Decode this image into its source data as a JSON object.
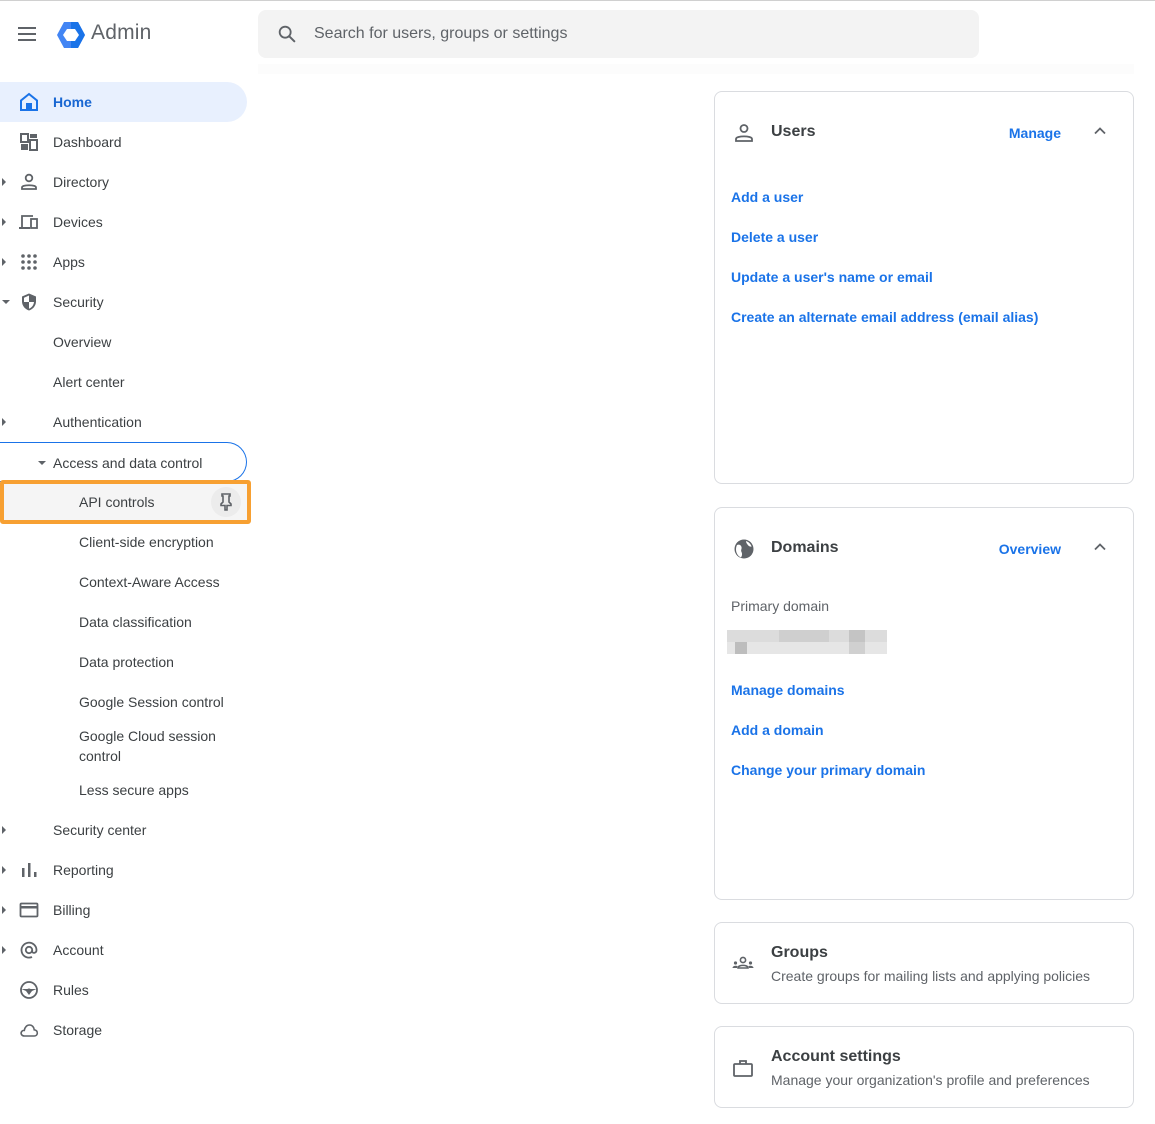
{
  "header": {
    "brand": "Admin",
    "search_placeholder": "Search for users, groups or settings",
    "search_value": ""
  },
  "sidebar": {
    "items": [
      {
        "label": "Home",
        "icon": "home-icon",
        "state": "selected"
      },
      {
        "label": "Dashboard",
        "icon": "dashboard-icon"
      },
      {
        "label": "Directory",
        "icon": "person-icon",
        "expandable": true
      },
      {
        "label": "Devices",
        "icon": "devices-icon",
        "expandable": true
      },
      {
        "label": "Apps",
        "icon": "apps-grid-icon",
        "expandable": true
      },
      {
        "label": "Security",
        "icon": "shield-icon",
        "expanded": true
      },
      {
        "label": "Overview"
      },
      {
        "label": "Alert center"
      },
      {
        "label": "Authentication",
        "expandable": true
      },
      {
        "label": "Access and data control",
        "expanded": true
      },
      {
        "label": "API controls",
        "highlighted": true,
        "pin_icon": "pin-icon"
      },
      {
        "label": "Client-side encryption"
      },
      {
        "label": "Context-Aware Access"
      },
      {
        "label": "Data classification"
      },
      {
        "label": "Data protection"
      },
      {
        "label": "Google Session control"
      },
      {
        "label": "Google Cloud session control"
      },
      {
        "label": "Less secure apps"
      },
      {
        "label": "Security center",
        "expandable": true
      },
      {
        "label": "Reporting",
        "icon": "bar-chart-icon",
        "expandable": true
      },
      {
        "label": "Billing",
        "icon": "credit-card-icon",
        "expandable": true
      },
      {
        "label": "Account",
        "icon": "at-sign-icon",
        "expandable": true
      },
      {
        "label": "Rules",
        "icon": "steering-wheel-icon"
      },
      {
        "label": "Storage",
        "icon": "cloud-icon"
      }
    ]
  },
  "cards": {
    "users": {
      "title": "Users",
      "action": "Manage",
      "links": [
        "Add a user",
        "Delete a user",
        "Update a user's name or email",
        "Create an alternate email address (email alias)"
      ]
    },
    "domains": {
      "title": "Domains",
      "action": "Overview",
      "primary_label": "Primary domain",
      "primary_value": "[redacted]",
      "links": [
        "Manage domains",
        "Add a domain",
        "Change your primary domain"
      ]
    },
    "groups": {
      "title": "Groups",
      "subtitle": "Create groups for mailing lists and applying policies"
    },
    "account_settings": {
      "title": "Account settings",
      "subtitle": "Manage your organization's profile and preferences"
    }
  },
  "colors": {
    "accent": "#1a73e8",
    "selected_bg": "#e8f0fe",
    "highlight_border": "#f7a032"
  }
}
